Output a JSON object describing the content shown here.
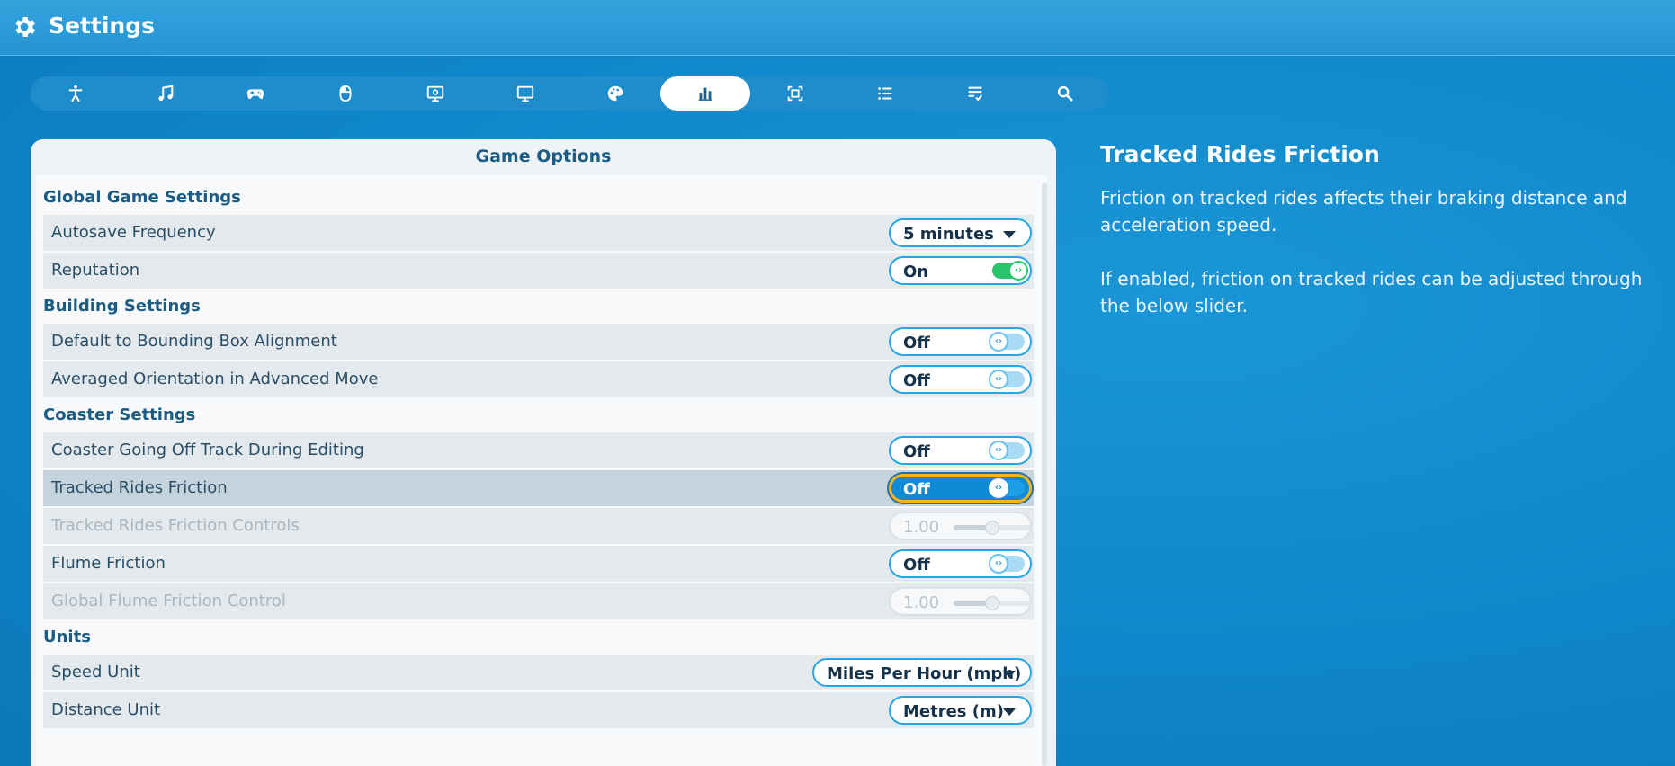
{
  "window": {
    "title": "Settings",
    "icon": "gear-icon"
  },
  "tabs": [
    {
      "icon": "accessibility-icon",
      "active": false
    },
    {
      "icon": "music-note-icon",
      "active": false
    },
    {
      "icon": "gamepad-icon",
      "active": false
    },
    {
      "icon": "mouse-icon",
      "active": false
    },
    {
      "icon": "display-settings-icon",
      "active": false
    },
    {
      "icon": "monitor-icon",
      "active": false
    },
    {
      "icon": "palette-icon",
      "active": false
    },
    {
      "icon": "bar-chart-icon",
      "active": true
    },
    {
      "icon": "screen-frame-icon",
      "active": false
    },
    {
      "icon": "list-icon",
      "active": false
    },
    {
      "icon": "checklist-icon",
      "active": false
    },
    {
      "icon": "search-icon",
      "active": false
    }
  ],
  "panel": {
    "title": "Game Options",
    "sections": {
      "global": "Global Game Settings",
      "building": "Building Settings",
      "coaster": "Coaster Settings",
      "units": "Units"
    },
    "rows": {
      "autosave": {
        "label": "Autosave Frequency",
        "value": "5 minutes"
      },
      "reputation": {
        "label": "Reputation",
        "value": "On"
      },
      "bounding_box": {
        "label": "Default to Bounding Box Alignment",
        "value": "Off"
      },
      "averaged_orientation": {
        "label": "Averaged Orientation in Advanced Move",
        "value": "Off"
      },
      "off_track": {
        "label": "Coaster Going Off Track During Editing",
        "value": "Off"
      },
      "tracked_friction": {
        "label": "Tracked Rides Friction",
        "value": "Off"
      },
      "tracked_friction_controls": {
        "label": "Tracked Rides Friction Controls",
        "value": "1.00",
        "level": 0.5
      },
      "flume_friction": {
        "label": "Flume Friction",
        "value": "Off"
      },
      "flume_friction_control": {
        "label": "Global Flume Friction Control",
        "value": "1.00",
        "level": 0.5
      },
      "speed_unit": {
        "label": "Speed Unit",
        "value": "Miles Per Hour (mph)"
      },
      "distance_unit": {
        "label": "Distance Unit",
        "value": "Metres (m)"
      }
    }
  },
  "help": {
    "title": "Tracked Rides Friction",
    "paragraph1": "Friction on tracked rides affects their braking distance and acceleration speed.",
    "paragraph2": "If enabled, friction on tracked rides can be adjusted through the below slider."
  },
  "colors": {
    "accent": "#28a6e4",
    "toggle_on": "#2ac56b",
    "focus_ring": "#f2b71b",
    "background": "#0f86c9"
  }
}
